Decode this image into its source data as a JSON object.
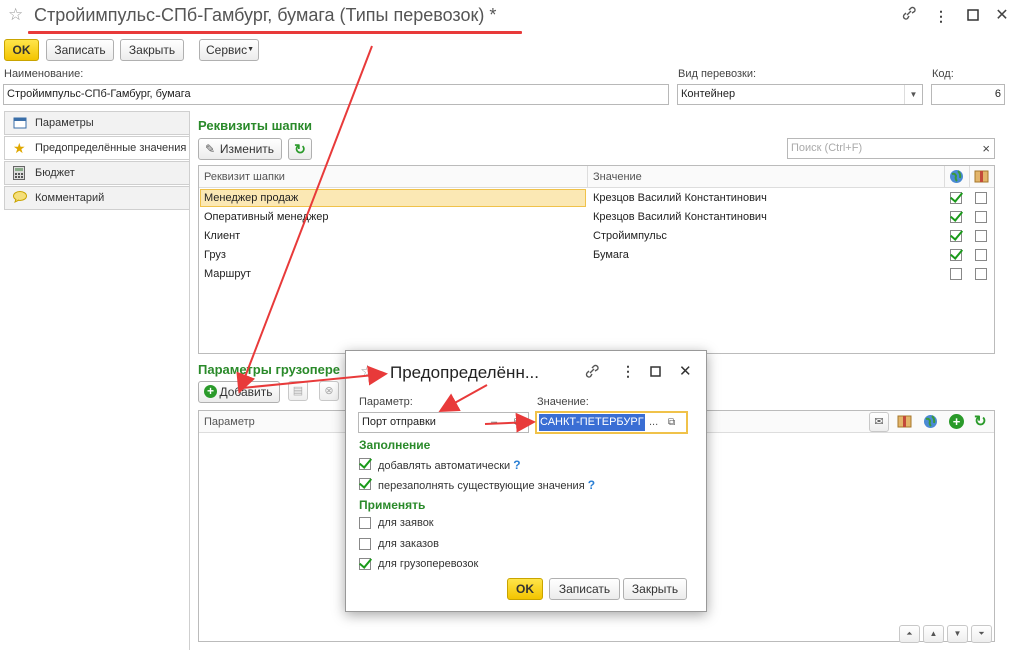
{
  "window": {
    "title": "Стройимпульс-СПб-Гамбург, бумага (Типы перевозок) *"
  },
  "toolbar": {
    "ok_label": "OK",
    "save_label": "Записать",
    "close_label": "Закрыть",
    "service_label": "Сервис"
  },
  "form": {
    "name_label": "Наименование:",
    "name_value": "Стройимпульс-СПб-Гамбург, бумага",
    "transport_kind_label": "Вид перевозки:",
    "transport_kind_value": "Контейнер",
    "code_label": "Код:",
    "code_value": "6"
  },
  "nav": {
    "items": [
      {
        "label": "Параметры",
        "icon": "parameters-icon"
      },
      {
        "label": "Предопределённые значения",
        "icon": "star-icon"
      },
      {
        "label": "Бюджет",
        "icon": "calculator-icon"
      },
      {
        "label": "Комментарий",
        "icon": "comment-icon"
      }
    ]
  },
  "header_section": {
    "title": "Реквизиты шапки",
    "edit_label": "Изменить",
    "search_placeholder": "Поиск (Ctrl+F)",
    "search_clear": "×",
    "columns": {
      "attribute": "Реквизит шапки",
      "value": "Значение"
    },
    "rows": [
      {
        "attribute": "Менеджер продаж",
        "value": "Крезцов Василий Константинович",
        "col1": true,
        "col2": false
      },
      {
        "attribute": "Оперативный менеджер",
        "value": "Крезцов Василий Константинович",
        "col1": true,
        "col2": false
      },
      {
        "attribute": "Клиент",
        "value": "Стройимпульс",
        "col1": true,
        "col2": false
      },
      {
        "attribute": "Груз",
        "value": "Бумага",
        "col1": true,
        "col2": false
      },
      {
        "attribute": "Маршрут",
        "value": "",
        "col1": false,
        "col2": false
      }
    ]
  },
  "cargo_section": {
    "title": "Параметры грузопере",
    "add_label": "Добавить",
    "columns": {
      "parameter": "Параметр"
    }
  },
  "dialog": {
    "title": "Предопределённ...",
    "param_label": "Параметр:",
    "param_value": "Порт отправки",
    "value_label": "Значение:",
    "value_value": "САНКТ-ПЕТЕРБУРГ",
    "ellipsis": "...",
    "fill_title": "Заполнение",
    "fill_options": [
      {
        "label": "добавлять автоматически",
        "checked": true
      },
      {
        "label": "перезаполнять существующие значения",
        "checked": true
      }
    ],
    "apply_title": "Применять",
    "apply_options": [
      {
        "label": "для заявок",
        "checked": false
      },
      {
        "label": "для заказов",
        "checked": false
      },
      {
        "label": "для грузоперевозок",
        "checked": true
      }
    ],
    "ok_label": "OK",
    "save_label": "Записать",
    "close_label": "Закрыть",
    "help_mark": "?"
  },
  "colors": {
    "accent_green": "#2a8a2a",
    "ok_yellow": "#f3c400",
    "annotation_red": "#e83a3a",
    "selection": "#fbe8b4"
  }
}
